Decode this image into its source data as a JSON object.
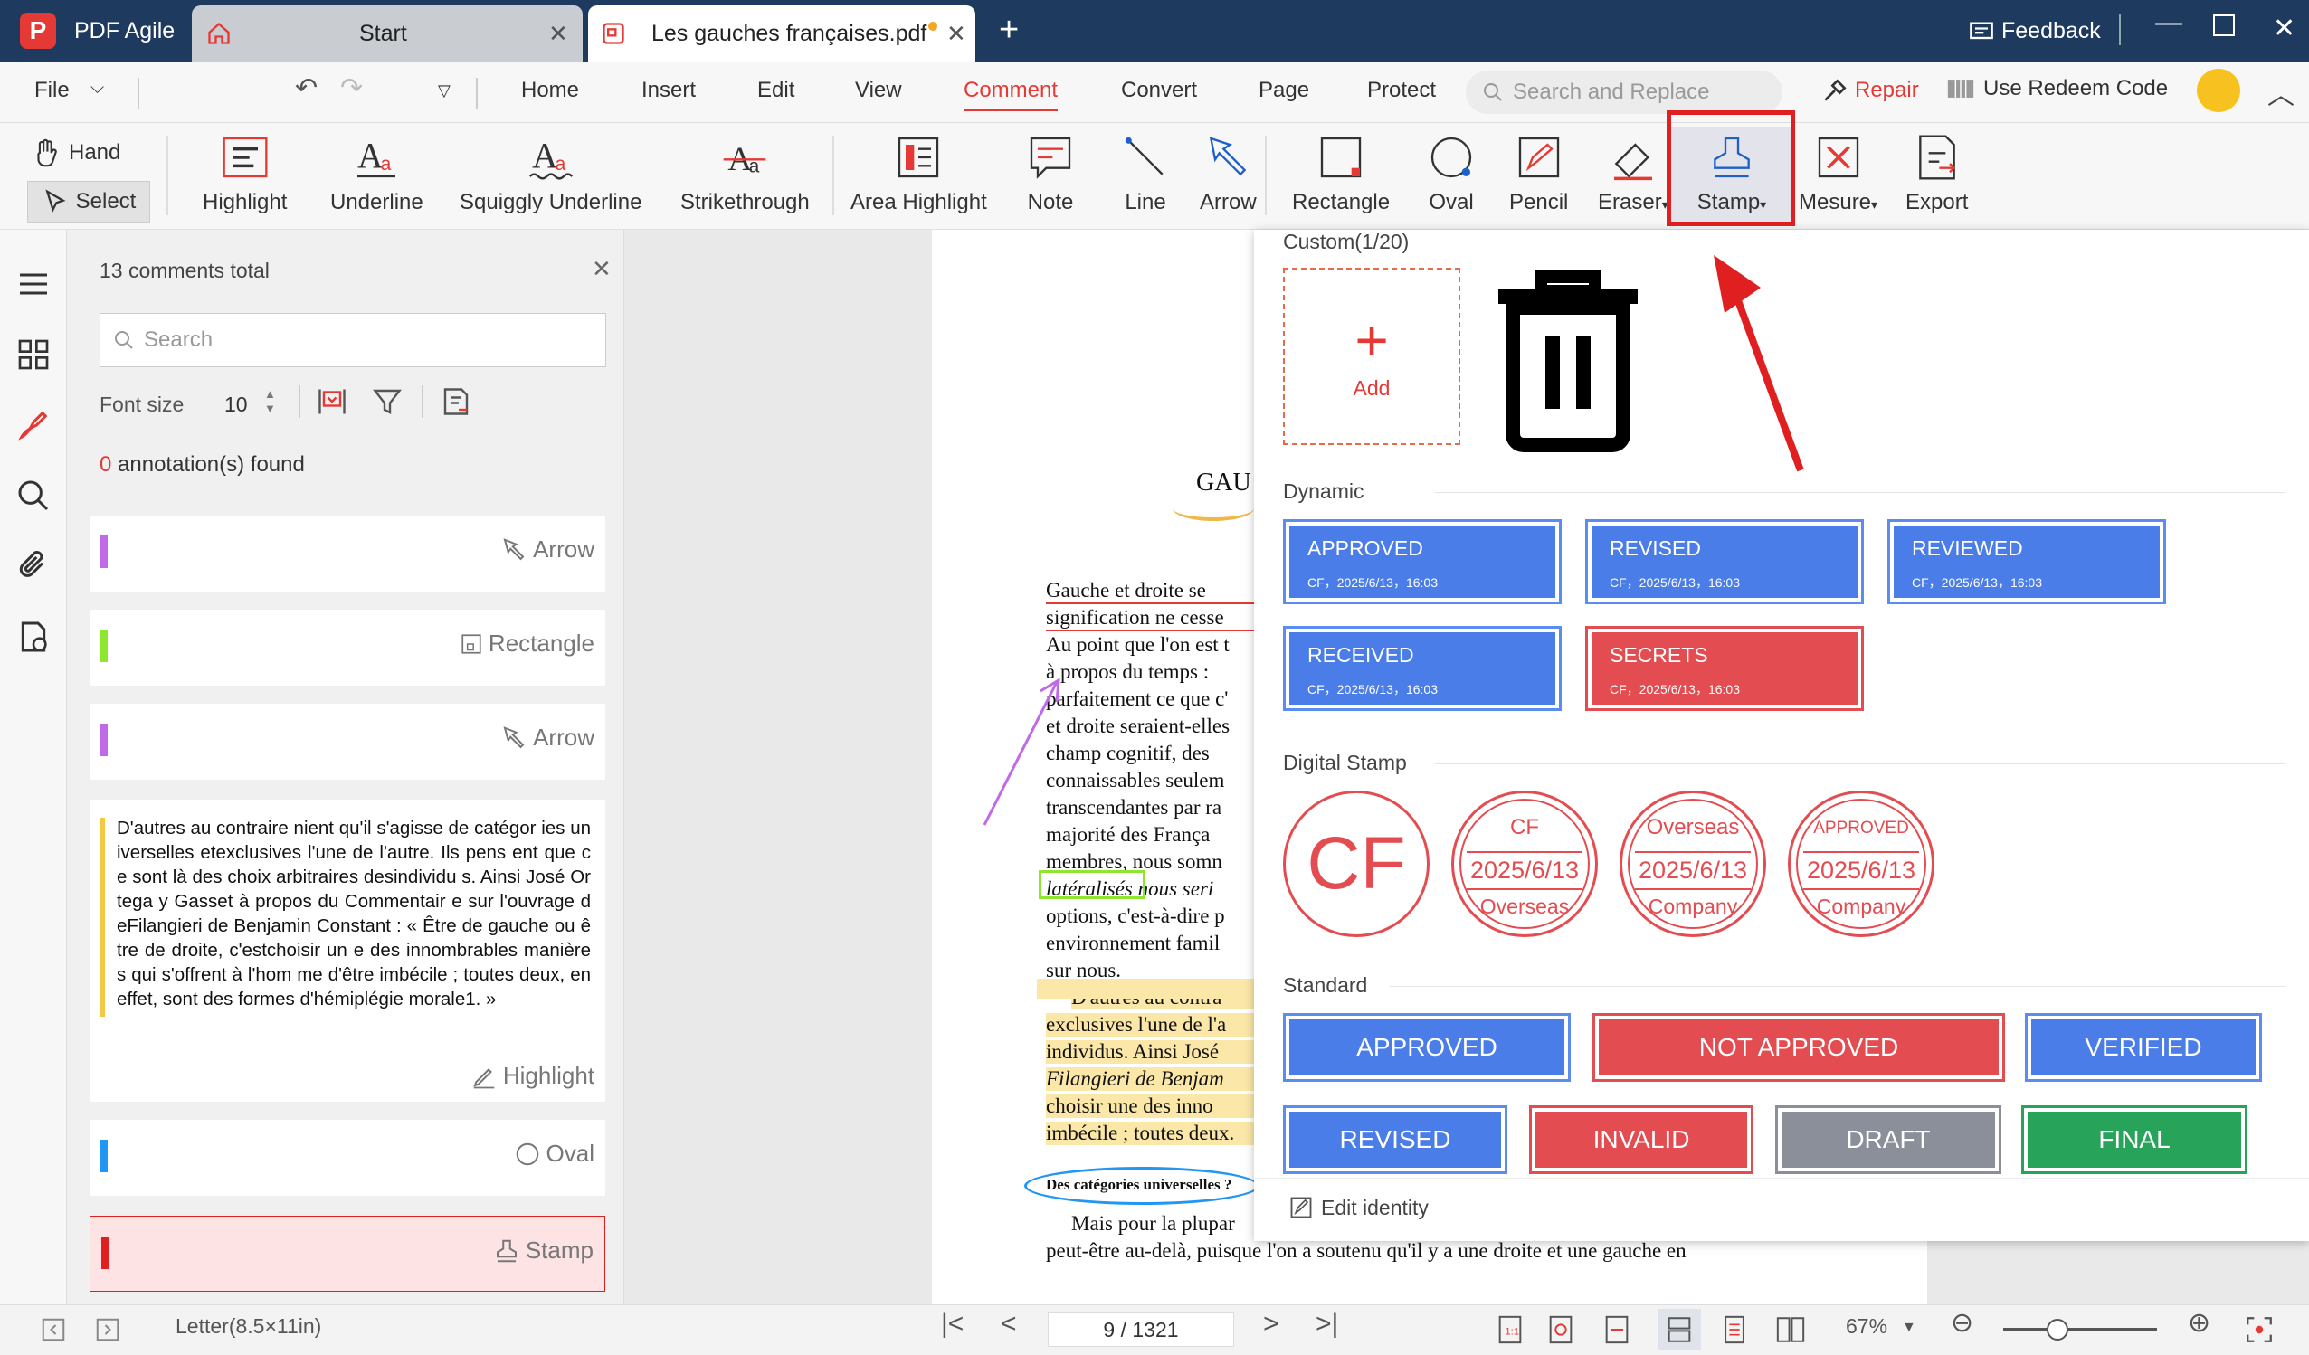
{
  "titlebar": {
    "app_name": "PDF Agile",
    "tabs": [
      {
        "label": "Start"
      },
      {
        "label": "Les gauches françaises.pdf"
      }
    ],
    "feedback": "Feedback"
  },
  "menubar": {
    "file": "File",
    "items": [
      "Home",
      "Insert",
      "Edit",
      "View",
      "Comment",
      "Convert",
      "Page",
      "Protect"
    ],
    "active": "Comment",
    "search_placeholder": "Search and Replace",
    "repair": "Repair",
    "redeem": "Use Redeem Code"
  },
  "toolbar": {
    "hand": "Hand",
    "select": "Select",
    "tools": [
      "Highlight",
      "Underline",
      "Squiggly Underline",
      "Strikethrough",
      "Area Highlight",
      "Note",
      "Line",
      "Arrow",
      "Rectangle",
      "Oval",
      "Pencil",
      "Eraser",
      "Stamp",
      "Mesure",
      "Export"
    ]
  },
  "panel": {
    "total": "13 comments total",
    "search_placeholder": "Search",
    "font_size_label": "Font size",
    "font_size_value": "10",
    "found_count": "0",
    "found_text": "annotation(s) found",
    "cards": [
      {
        "type": "Arrow",
        "color": "#c06ae8"
      },
      {
        "type": "Rectangle",
        "color": "#8fe62e"
      },
      {
        "type": "Arrow",
        "color": "#c06ae8"
      },
      {
        "type": "Highlight",
        "color": "#f5c842",
        "text": "D'autres au contraire nient qu'il s'agisse de catégor ies universelles etexclusives l'une de l'autre. Ils pens ent que ce sont là des choix arbitraires desindividu s. Ainsi José Ortega y Gasset à propos du Commentair e sur l'ouvrage deFilangieri de Benjamin Constant : « Être de gauche ou être de droite, c'estchoisir un e des innombrables manières qui s'offrent à l'hom me d'être imbécile ; toutes deux, en effet, sont des formes d'hémiplégie morale1. »"
      },
      {
        "type": "Oval",
        "color": "#2196f3"
      },
      {
        "type": "Stamp",
        "color": "#e02020"
      }
    ]
  },
  "document": {
    "heading": "GAU",
    "lines": [
      "Gauche et droite se",
      "signification ne cesse",
      "Au point que l'on est t",
      "à propos du temps :",
      "parfaitement ce que c'",
      "et droite seraient-elles",
      "champ cognitif, des",
      "connaissables seulem",
      "transcendantes par ra",
      "majorité des França",
      "membres, nous somn",
      "latéralisés nous seri",
      "options, c'est-à-dire p",
      "environnement famil",
      "sur nous.",
      "D'autres au contra",
      "exclusives l'une de l'a",
      "individus. Ainsi José",
      "Filangieri de Benjam",
      "choisir une des inno",
      "imbécile ; toutes deux."
    ],
    "subheading": "Des catégories universelles ?",
    "last_lines": [
      "Mais pour la plupar",
      "peut-être au-delà, puisque l'on a soutenu qu'il y a une droite et une gauche en"
    ]
  },
  "stamp_panel": {
    "custom_label": "Custom(1/20)",
    "add_label": "Add",
    "dynamic_label": "Dynamic",
    "dynamic": [
      {
        "title": "APPROVED",
        "sub": "CF，2025/6/13，16:03",
        "color": "#4a7de8"
      },
      {
        "title": "REVISED",
        "sub": "CF，2025/6/13，16:03",
        "color": "#4a7de8"
      },
      {
        "title": "REVIEWED",
        "sub": "CF，2025/6/13，16:03",
        "color": "#4a7de8"
      },
      {
        "title": "RECEIVED",
        "sub": "CF，2025/6/13，16:03",
        "color": "#4a7de8"
      },
      {
        "title": "SECRETS",
        "sub": "CF，2025/6/13，16:03",
        "color": "#e34c50"
      }
    ],
    "digital_label": "Digital Stamp",
    "digital": [
      {
        "top": "",
        "mid": "CF",
        "bottom": ""
      },
      {
        "top": "CF",
        "mid": "2025/6/13",
        "bottom": "Overseas"
      },
      {
        "top": "Overseas",
        "mid": "2025/6/13",
        "bottom": "Company"
      },
      {
        "top": "APPROVED",
        "mid": "2025/6/13",
        "bottom": "Company"
      }
    ],
    "standard_label": "Standard",
    "standard": [
      {
        "label": "APPROVED",
        "color": "#4a7de8"
      },
      {
        "label": "NOT APPROVED",
        "color": "#e34c50"
      },
      {
        "label": "VERIFIED",
        "color": "#4a7de8"
      },
      {
        "label": "REVISED",
        "color": "#4a7de8"
      },
      {
        "label": "INVALID",
        "color": "#e34c50"
      },
      {
        "label": "DRAFT",
        "color": "#8b8f99"
      },
      {
        "label": "FINAL",
        "color": "#27a35a"
      }
    ],
    "edit_identity": "Edit identity"
  },
  "statusbar": {
    "page_size": "Letter(8.5×11in)",
    "page_indicator": "9 / 1321",
    "zoom": "67%"
  }
}
